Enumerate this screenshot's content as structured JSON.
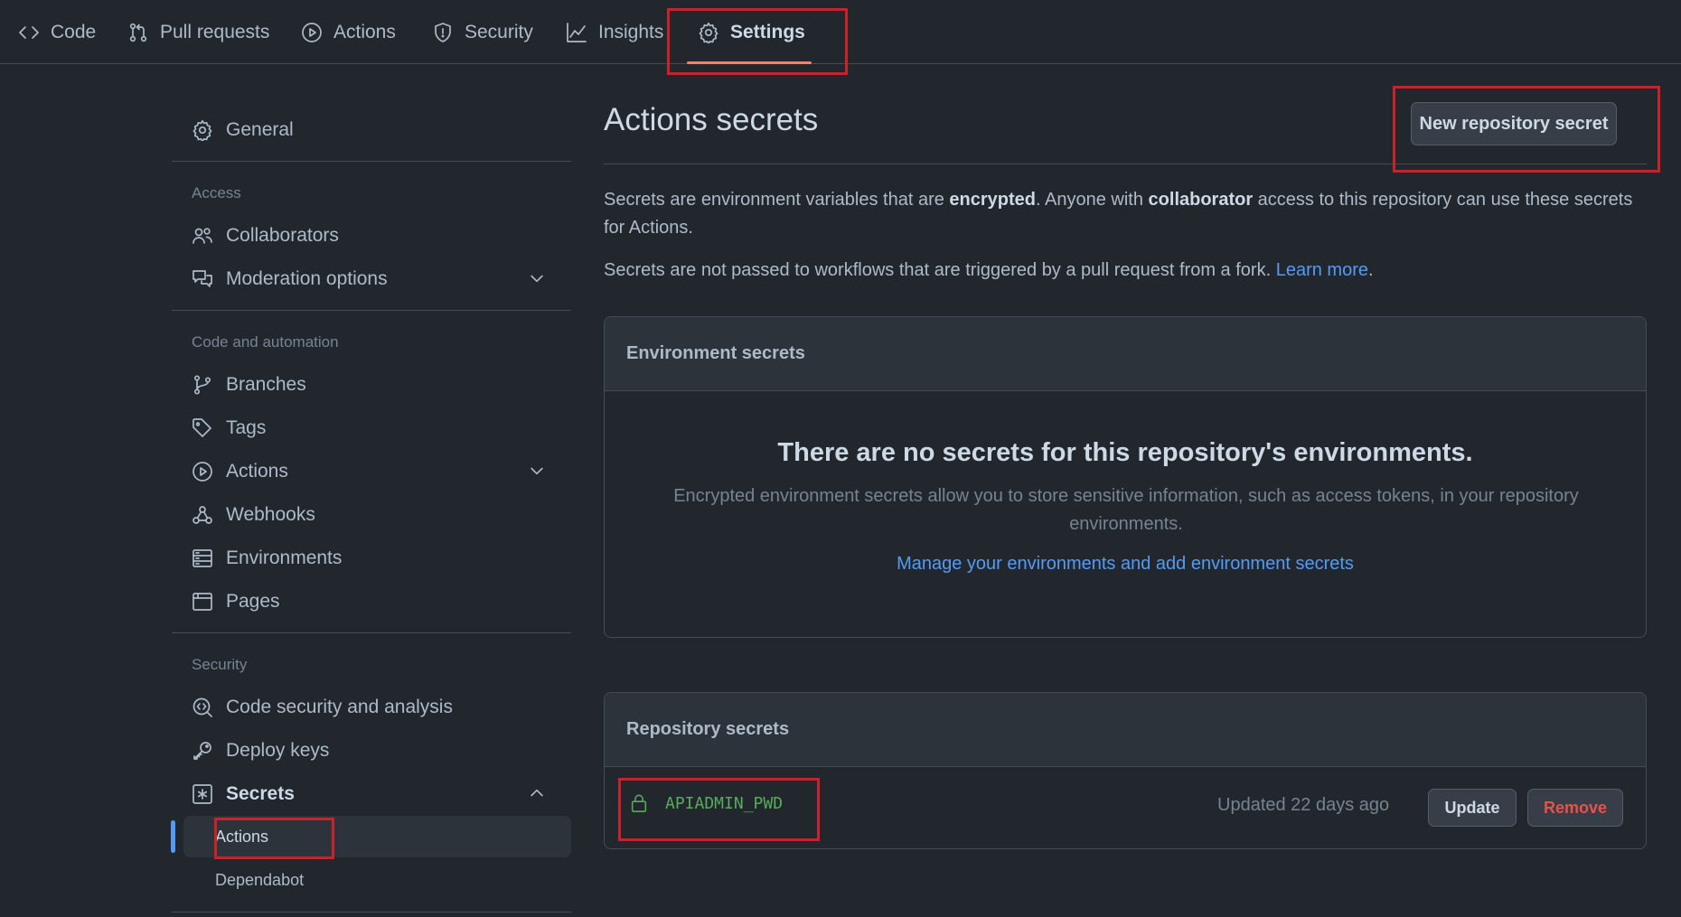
{
  "nav": {
    "tabs": [
      {
        "label": "Code",
        "icon": "code-icon"
      },
      {
        "label": "Pull requests",
        "icon": "pull-request-icon"
      },
      {
        "label": "Actions",
        "icon": "play-icon"
      },
      {
        "label": "Security",
        "icon": "shield-icon"
      },
      {
        "label": "Insights",
        "icon": "graph-icon"
      },
      {
        "label": "Settings",
        "icon": "gear-icon",
        "active": true
      }
    ]
  },
  "sidebar": {
    "general": "General",
    "access_heading": "Access",
    "collaborators": "Collaborators",
    "moderation": "Moderation options",
    "code_heading": "Code and automation",
    "branches": "Branches",
    "tags": "Tags",
    "actions": "Actions",
    "webhooks": "Webhooks",
    "environments": "Environments",
    "pages": "Pages",
    "security_heading": "Security",
    "code_security": "Code security and analysis",
    "deploy_keys": "Deploy keys",
    "secrets": "Secrets",
    "secrets_actions": "Actions",
    "secrets_dependabot": "Dependabot"
  },
  "main": {
    "title": "Actions secrets",
    "new_secret_button": "New repository secret",
    "intro": {
      "part1": "Secrets are environment variables that are ",
      "bold1": "encrypted",
      "part2": ". Anyone with ",
      "bold2": "collaborator",
      "part3": " access to this repository can use these secrets for Actions."
    },
    "fork_note": {
      "text": "Secrets are not passed to workflows that are triggered by a pull request from a fork. ",
      "link": "Learn more",
      "after": "."
    },
    "env_secrets": {
      "header": "Environment secrets",
      "blank_title": "There are no secrets for this repository's environments.",
      "blank_desc": "Encrypted environment secrets allow you to store sensitive information, such as access tokens, in your repository environments.",
      "manage_link": "Manage your environments and add environment secrets"
    },
    "repo_secrets": {
      "header": "Repository secrets",
      "items": [
        {
          "name": "APIADMIN_PWD",
          "updated": "Updated 22 days ago",
          "update_label": "Update",
          "remove_label": "Remove"
        }
      ]
    }
  },
  "colors": {
    "background": "#22272e",
    "highlight": "#c9222a",
    "accent": "#539bf5",
    "tab_underline": "#f78166",
    "secret_name": "#57ab5a",
    "danger": "#e5534b"
  }
}
